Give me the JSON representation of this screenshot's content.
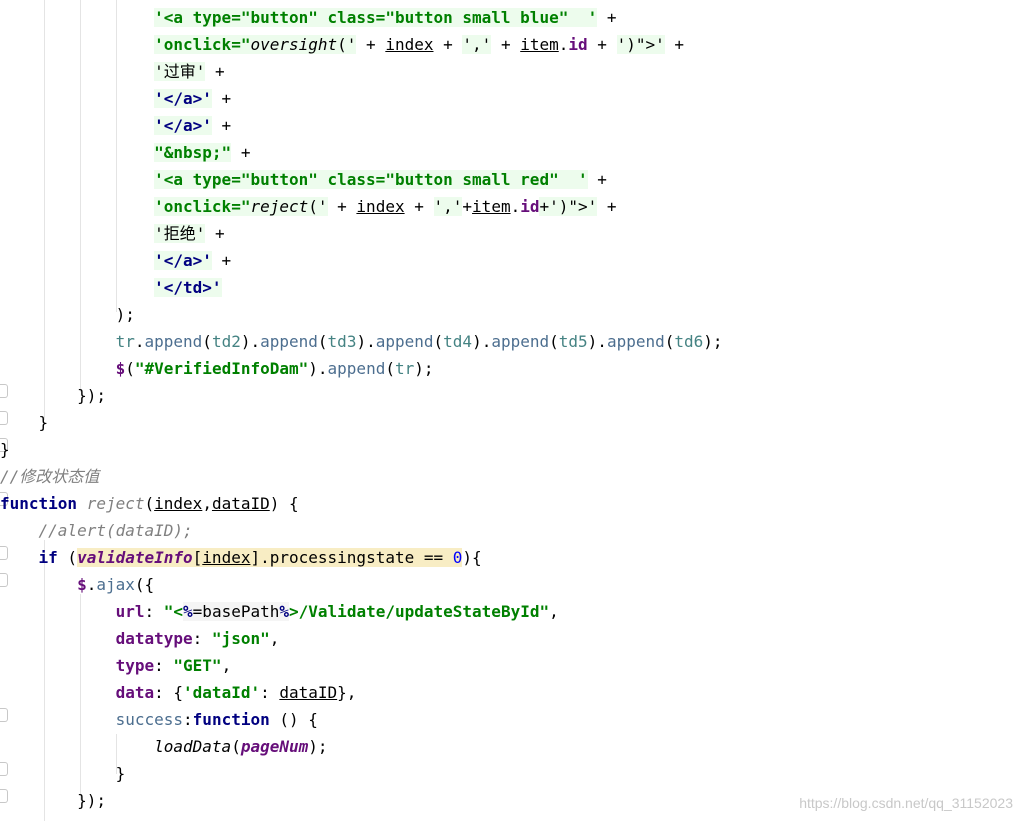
{
  "code": {
    "l1": {
      "s1": "'<a type=\"button\" class=\"button small blue\"  '",
      "s2": " +"
    },
    "l2": {
      "a": "'onclick=\"",
      "b": "oversight",
      "c": "('",
      "d": " + ",
      "e": "index",
      "f": " + ",
      "g": "','",
      "h": " + ",
      "i": "item",
      "j": ".",
      "k": "id",
      "m": " + ",
      "n": "')\">'",
      "o": " +"
    },
    "l3": {
      "a": "'过审'",
      "b": " +"
    },
    "l4": {
      "a": "'</a>'",
      "b": " +"
    },
    "l5": {
      "a": "'</a>'",
      "b": " +"
    },
    "l6": {
      "a": "\"&nbsp;\"",
      "b": " +"
    },
    "l7": {
      "s1": "'<a type=\"button\" class=\"button small red\"  '",
      "s2": " +"
    },
    "l8": {
      "a": "'onclick=\"",
      "b": "reject",
      "c": "('",
      "d": " + ",
      "e": "index",
      "f": " + ",
      "g": "','",
      "h": "+",
      "i": "item",
      "j": ".",
      "k": "id",
      "m": "+')\">'",
      "o": " +"
    },
    "l9": {
      "a": "'拒绝'",
      "b": " +"
    },
    "l10": {
      "a": "'</a>'",
      "b": " +"
    },
    "l11": {
      "a": "'</td>'"
    },
    "l12": {
      "a": ");"
    },
    "l13": {
      "a": "tr",
      "b": ".",
      "c": "append",
      "d": "(",
      "e": "td2",
      "f": ").",
      "g": "append",
      "h": "(",
      "i": "td3",
      "j": ").",
      "k": "append",
      "m": "(",
      "n": "td4",
      "o": ").",
      "p": "append",
      "q": "(",
      "r": "td5",
      "s": ").",
      "t": "append",
      "u": "(",
      "v": "td6",
      "w": ");"
    },
    "l14": {
      "a": "$",
      "b": "(",
      "c": "\"#VerifiedInfoDam\"",
      "d": ").",
      "e": "append",
      "f": "(",
      "g": "tr",
      "h": ");"
    },
    "l15": {
      "a": "});"
    },
    "l16": {
      "a": "}"
    },
    "l17": {
      "a": "}"
    },
    "l18": {
      "a": "//修改状态值"
    },
    "l19": {
      "a": "function",
      "b": " ",
      "c": "reject",
      "d": "(",
      "e": "index",
      "f": ",",
      "g": "dataID",
      "h": ") {"
    },
    "l20": {
      "a": "//alert(dataID);"
    },
    "l21": {
      "a": "if",
      "b": " (",
      "c": "validateInfo",
      "d": "[",
      "e": "index",
      "f": "].processingstate == ",
      "g": "0",
      "h": "){"
    },
    "l22": {
      "a": "$",
      "b": ".",
      "c": "ajax",
      "d": "({"
    },
    "l23": {
      "a": "url",
      "b": ": ",
      "c": "\"<",
      "d": "%",
      "e": "=basePath",
      "f": "%",
      "g": ">/Validate/updateStateById\"",
      "h": ","
    },
    "l24": {
      "a": "datatype",
      "b": ": ",
      "c": "\"json\"",
      "d": ","
    },
    "l25": {
      "a": "type",
      "b": ": ",
      "c": "\"GET\"",
      "d": ","
    },
    "l26": {
      "a": "data",
      "b": ": {",
      "c": "'dataId'",
      "d": ": ",
      "e": "dataID",
      "f": "},"
    },
    "l27": {
      "a": "success",
      "b": ":",
      "c": "function",
      "d": " () {"
    },
    "l28": {
      "a": "loadData",
      "b": "(",
      "c": "pageNum",
      "d": ");"
    },
    "l29": {
      "a": "}"
    },
    "l30": {
      "a": "});"
    }
  },
  "watermark": "https://blog.csdn.net/qq_31152023",
  "colors": {
    "keyword": "#000080",
    "string": "#008000",
    "comment": "#808080",
    "global": "#660e7a",
    "highlight": "#f8edc4"
  }
}
